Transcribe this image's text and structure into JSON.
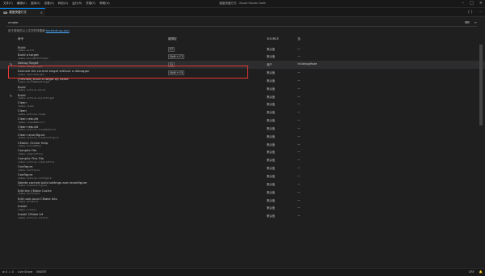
{
  "window": {
    "menus": [
      "文件(F)",
      "编辑(E)",
      "选择(S)",
      "查看(V)",
      "转到(G)",
      "运行(R)",
      "终端(T)",
      "帮助(H)"
    ],
    "title": "键盘快捷方式 - Visual Studio Code"
  },
  "tab": {
    "label": "键盘快捷方式"
  },
  "search": {
    "value": "cmake",
    "placeholder": ""
  },
  "hint": {
    "text": "用于搜索的以上文字的快捷键",
    "link": "keybindings.json"
  },
  "headers": {
    "command": "命令",
    "keybinding": "键绑定",
    "source": "SOURCE",
    "when": "当"
  },
  "rows": [
    {
      "name": "Build",
      "cmd": "cmake.build",
      "key": "F7",
      "source": "默认值",
      "when": "—"
    },
    {
      "name": "Build a target",
      "cmd": "cmake.buildWithTarget",
      "key": "Shift + F7",
      "source": "默认值",
      "when": "—"
    },
    {
      "name": "Debug Target",
      "cmd": "cmake.debugTarget",
      "key": "F5",
      "source": "用户",
      "when": "!inDebugMode",
      "selected": true,
      "edit_icon": true
    },
    {
      "name": "Execute the current target without a debugger",
      "cmd": "cmake.launchTarget",
      "key": "Shift + F5",
      "source": "默认值",
      "when": "—"
    },
    {
      "name": "[Preview] Build a target by name",
      "cmd": "cmake.buildNamedTarget",
      "key": "",
      "source": "默认值",
      "when": "—"
    },
    {
      "name": "Build",
      "cmd": "cmake.outline.build",
      "key": "",
      "source": "默认值",
      "when": "—"
    },
    {
      "name": "Build",
      "cmd": "cmake.outline.buildTarget",
      "key": "",
      "source": "默认值",
      "when": "—",
      "edit_icon": true
    },
    {
      "name": "Clean",
      "cmd": "cmake.clean",
      "key": "",
      "source": "默认值",
      "when": "—"
    },
    {
      "name": "Clean",
      "cmd": "cmake.outline.clean",
      "key": "",
      "source": "默认值",
      "when": "—"
    },
    {
      "name": "Clean rebuild",
      "cmd": "cmake.cleanRebuild",
      "key": "",
      "source": "默认值",
      "when": "—"
    },
    {
      "name": "Clean rebuild",
      "cmd": "cmake.outline.cleanRebuild",
      "key": "",
      "source": "默认值",
      "when": "—"
    },
    {
      "name": "Clean reconfigure",
      "cmd": "cmake.outline.cleanConfigure",
      "key": "",
      "source": "默认值",
      "when": "—"
    },
    {
      "name": "CMake: Online Help",
      "cmd": "cmake.onlineHelp",
      "key": "",
      "source": "默认值",
      "when": "—"
    },
    {
      "name": "Compile File",
      "cmd": "cmake.compileFile",
      "key": "",
      "source": "默认值",
      "when": "—"
    },
    {
      "name": "Compile This File",
      "cmd": "cmake.outline.compileFile",
      "key": "",
      "source": "默认值",
      "when": "—"
    },
    {
      "name": "Configure",
      "cmd": "cmake.configure",
      "key": "",
      "source": "默认值",
      "when": "—"
    },
    {
      "name": "Configure",
      "cmd": "cmake.outline.configure",
      "key": "",
      "source": "默认值",
      "when": "—"
    },
    {
      "name": "Delete cached build settings and reconfigure",
      "cmd": "cmake.cleanConfigure",
      "key": "",
      "source": "默认值",
      "when": "—"
    },
    {
      "name": "Edit the CMake Cache",
      "cmd": "cmake.editCache",
      "key": "",
      "source": "默认值",
      "when": "—"
    },
    {
      "name": "Edit user-local CMake kits",
      "cmd": "cmake.editKits",
      "key": "",
      "source": "默认值",
      "when": "—"
    },
    {
      "name": "Install",
      "cmd": "cmake.install",
      "key": "",
      "source": "默认值",
      "when": "—"
    },
    {
      "name": "Install CMake kit",
      "cmd": "cmake.outline.install",
      "key": "",
      "source": "默认值",
      "when": "—"
    }
  ],
  "status": {
    "left": [
      "Live Share",
      "INSERT"
    ],
    "right": [
      "CRF"
    ]
  },
  "colors": {
    "accent": "#0078d4",
    "highlight": "#e53935"
  }
}
